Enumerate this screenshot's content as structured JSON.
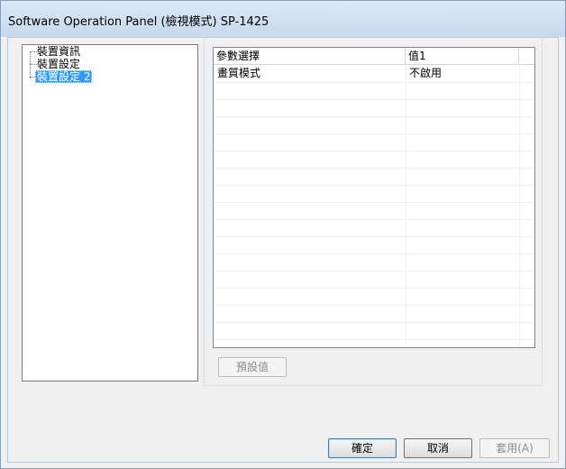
{
  "window": {
    "title": "Software Operation Panel (檢視模式) SP-1425"
  },
  "tree": {
    "items": [
      {
        "label": "裝置資訊",
        "selected": false
      },
      {
        "label": "裝置設定",
        "selected": false
      },
      {
        "label": "裝置設定 2",
        "selected": true
      }
    ]
  },
  "list": {
    "columns": [
      "參數選擇",
      "值1"
    ],
    "rows": [
      {
        "param": "畫質模式",
        "value": "不啟用"
      }
    ],
    "empty_rows": 15
  },
  "buttons": {
    "default_values": "預設值",
    "ok": "確定",
    "cancel": "取消",
    "apply": "套用(A)"
  }
}
